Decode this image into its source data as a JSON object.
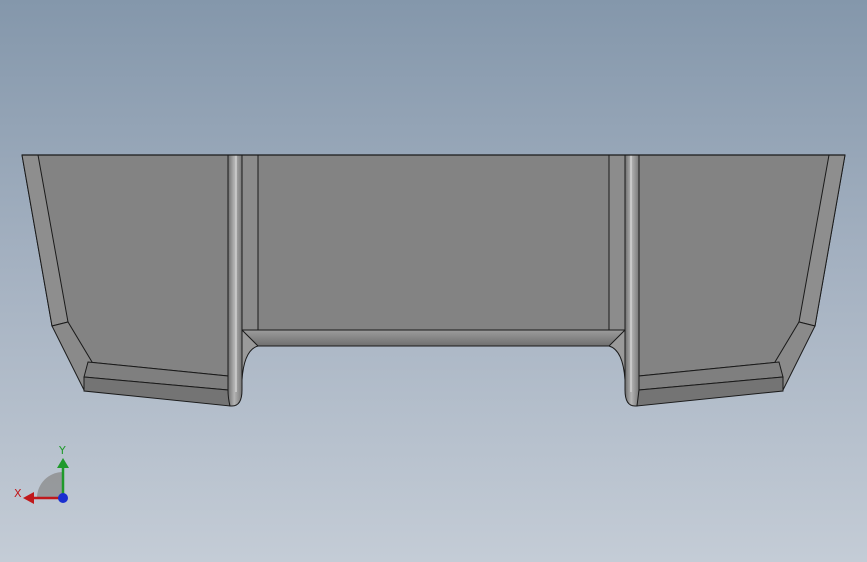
{
  "viewport": {
    "background_top": "#8497ab",
    "background_bottom": "#c4ccd6"
  },
  "model": {
    "face_color": "#838383",
    "fillet_color": "#9a9a9a",
    "edge_color": "#1a1a1a"
  },
  "triad": {
    "x_label": "X",
    "y_label": "Y",
    "x_color": "#c0181b",
    "y_color": "#1f9a2b",
    "z_color": "#1a2fd0"
  }
}
